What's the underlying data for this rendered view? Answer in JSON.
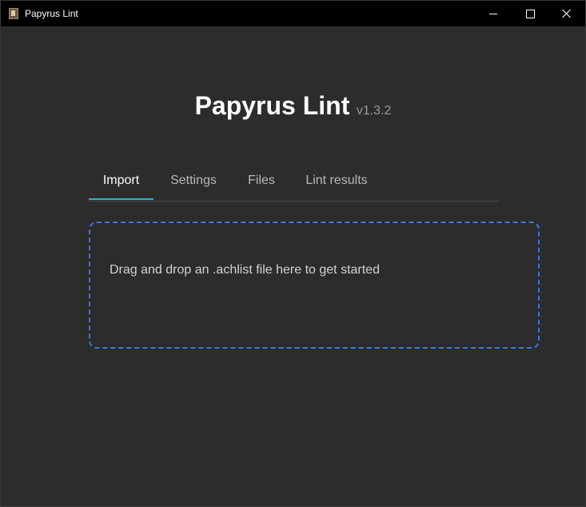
{
  "window": {
    "title": "Papyrus Lint",
    "controls": {
      "minimize_icon": "minimize-icon",
      "maximize_icon": "maximize-icon",
      "close_icon": "close-icon"
    }
  },
  "header": {
    "app_name": "Papyrus Lint",
    "version": "v1.3.2"
  },
  "tabs": [
    {
      "label": "Import",
      "active": true
    },
    {
      "label": "Settings",
      "active": false
    },
    {
      "label": "Files",
      "active": false
    },
    {
      "label": "Lint results",
      "active": false
    }
  ],
  "dropzone": {
    "message": "Drag and drop an .achlist file here to get started"
  },
  "colors": {
    "background": "#2c2c2c",
    "titlebar": "#000000",
    "accent_tab": "#2bb3d4",
    "dropzone_border": "#3a78d8"
  }
}
